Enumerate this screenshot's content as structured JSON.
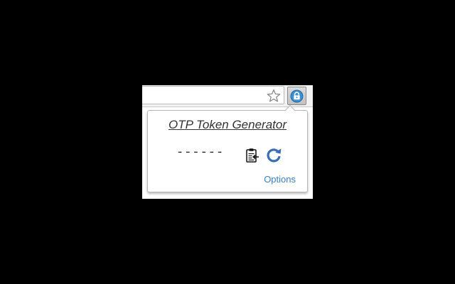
{
  "popup": {
    "title": "OTP Token Generator",
    "token": "------",
    "copy_icon": "clipboard-icon",
    "refresh_icon": "refresh-icon",
    "options_label": "Options"
  },
  "toolbar": {
    "bookmark_icon": "star-icon",
    "extension_icon": "lock-icon"
  },
  "colors": {
    "background": "#000000",
    "link": "#3a7fc1",
    "refresh_icon": "#3b6cb8",
    "extension_icon": "#3a8fd0"
  }
}
